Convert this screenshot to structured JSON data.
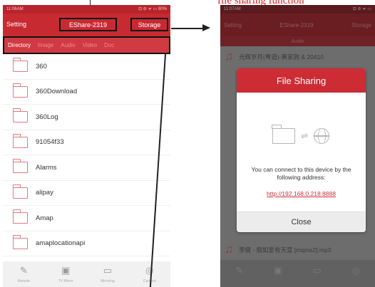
{
  "annotation": {
    "caption": "file sharing function"
  },
  "left": {
    "status": {
      "time": "11:06AM",
      "icons": "⊡ ⊘ ᯤ ▭ 80%"
    },
    "app_bar": {
      "setting": "Setting",
      "device": "EShare-2319",
      "storage": "Storage"
    },
    "tabs": [
      "Directory",
      "Image",
      "Audio",
      "Video",
      "Doc"
    ],
    "directories": [
      "360",
      "360Download",
      "360Log",
      "91054f33",
      "Alarms",
      "alipay",
      "Amap",
      "amaplocationapi"
    ],
    "nav": [
      {
        "icon": "remote-icon",
        "glyph": "✎",
        "label": "Remote"
      },
      {
        "icon": "tv-mirror-icon",
        "glyph": "▣",
        "label": "TV Mirror"
      },
      {
        "icon": "mirroring-icon",
        "glyph": "▭",
        "label": "Mirroring"
      },
      {
        "icon": "camera-icon",
        "glyph": "◎",
        "label": "Camera"
      }
    ]
  },
  "right": {
    "status": {
      "time": "11:07AM",
      "icons": "⊡ ⊘ ᯤ ▭"
    },
    "app_bar": {
      "setting": "Setting",
      "device": "EShare-2319",
      "storage": "Storage"
    },
    "tab": "Audio",
    "rows": [
      {
        "text": "光辉岁月(粤语)-黄家驹 & 20410"
      },
      {
        "text": "李健 - 假如爱有天意 [mqms2].mp3"
      }
    ],
    "dialog": {
      "title": "File Sharing",
      "message": "You can connect to this device by the following address:",
      "url": "http://192.168.0.218:8888",
      "close": "Close"
    }
  },
  "colors": {
    "accent": "#c82a32",
    "link": "#c8323a",
    "folder": "#e07a80"
  }
}
